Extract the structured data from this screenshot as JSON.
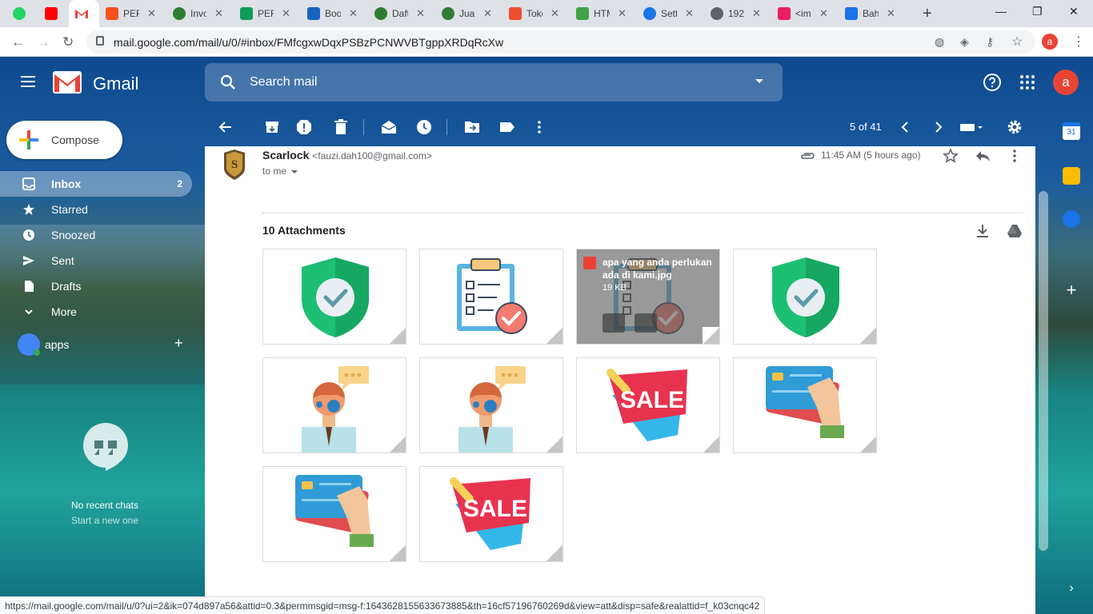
{
  "browser": {
    "tabs": [
      {
        "title": "",
        "icon": "whatsapp-icon",
        "color": "#25d366"
      },
      {
        "title": "",
        "icon": "youtube-icon",
        "color": "#ff0000"
      },
      {
        "title": "",
        "icon": "gmail-icon",
        "color": "#ea4335"
      },
      {
        "title": "PER",
        "icon": "tab-icon",
        "color": "#f4511e"
      },
      {
        "title": "Invo",
        "icon": "tab-icon",
        "color": "#2e7d32"
      },
      {
        "title": "PER",
        "icon": "tab-icon",
        "color": "#0f9d58"
      },
      {
        "title": "Boo",
        "icon": "blogger-icon",
        "color": "#1565c0"
      },
      {
        "title": "Daft",
        "icon": "tab-icon",
        "color": "#2e7d32"
      },
      {
        "title": "Jual",
        "icon": "tab-icon",
        "color": "#2e7d32"
      },
      {
        "title": "Toko",
        "icon": "shopee-icon",
        "color": "#ee4d2d"
      },
      {
        "title": "HTM",
        "icon": "tab-icon",
        "color": "#43a047"
      },
      {
        "title": "Setti",
        "icon": "gear-icon",
        "color": "#1a73e8"
      },
      {
        "title": "192",
        "icon": "globe-icon",
        "color": "#5f6368"
      },
      {
        "title": "<im",
        "icon": "tab-icon",
        "color": "#e91e63"
      },
      {
        "title": "Bah",
        "icon": "tab-icon",
        "color": "#1a73e8"
      }
    ],
    "url": "mail.google.com/mail/u/0/#inbox/FMfcgxwDqxPSBzPCNWVBTgppXRDqRcXw",
    "profile_initial": "a",
    "status_url": "https://mail.google.com/mail/u/0?ui=2&ik=074d897a56&attid=0.3&permmsgid=msg-f:1643628155633673885&th=16cf57196760269d&view=att&disp=safe&realattid=f_k03cnqc42"
  },
  "gmail": {
    "logo_text": "Gmail",
    "search_placeholder": "Search mail",
    "avatar_initial": "a",
    "compose_label": "Compose",
    "nav": [
      {
        "label": "Inbox",
        "count": "2",
        "icon": "inbox-icon"
      },
      {
        "label": "Starred",
        "count": "",
        "icon": "star-icon"
      },
      {
        "label": "Snoozed",
        "count": "",
        "icon": "clock-icon"
      },
      {
        "label": "Sent",
        "count": "",
        "icon": "send-icon"
      },
      {
        "label": "Drafts",
        "count": "",
        "icon": "draft-icon"
      },
      {
        "label": "More",
        "count": "",
        "icon": "chevron-down-icon"
      }
    ],
    "apps_label": "apps",
    "no_recent": "No recent chats",
    "start_new": "Start a new one",
    "pager": "5 of 41"
  },
  "message": {
    "sender_name": "Scarlock",
    "sender_email": "<fauzi.dah100@gmail.com>",
    "to": "to me",
    "time": "11:45 AM (5 hours ago)",
    "attachments_title": "10 Attachments",
    "attachments": [
      {
        "type": "shield"
      },
      {
        "type": "checklist"
      },
      {
        "type": "checklist",
        "hover": true,
        "name": "apa yang anda perlukan ada di kami.jpg",
        "size": "19 KB"
      },
      {
        "type": "shield"
      },
      {
        "type": "support"
      },
      {
        "type": "support"
      },
      {
        "type": "sale",
        "label": "SALE"
      },
      {
        "type": "card"
      },
      {
        "type": "card"
      },
      {
        "type": "sale",
        "label": "SALE"
      }
    ]
  },
  "colors": {
    "accent": "#1a73e8",
    "gmail_red": "#ea4335",
    "shield_green": "#1dbf73",
    "sale_red": "#e8334f"
  }
}
